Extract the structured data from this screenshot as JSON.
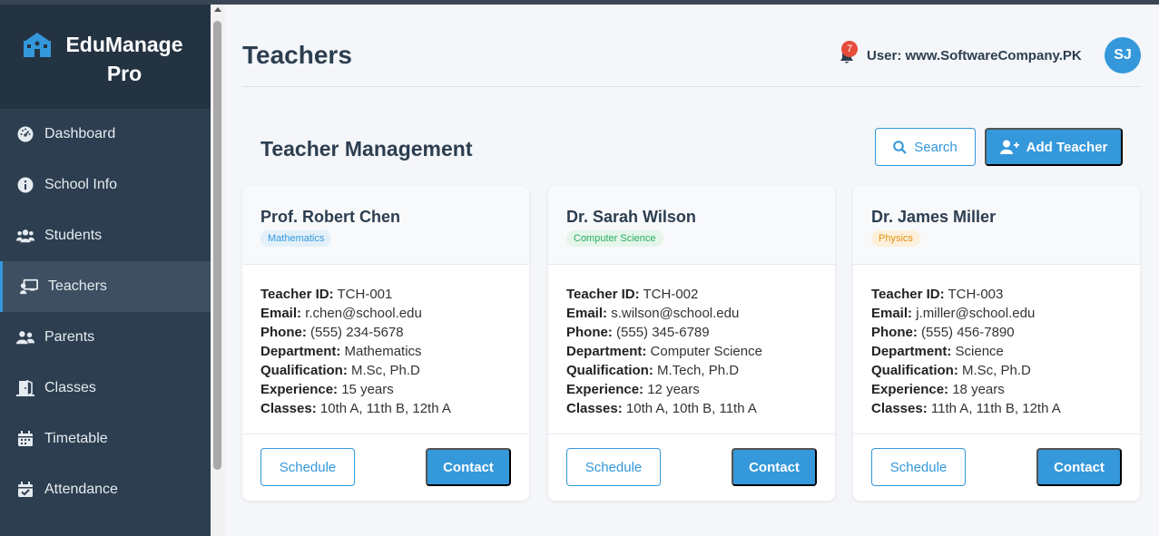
{
  "app": {
    "brand_line1": "EduManage",
    "brand_line2": "Pro"
  },
  "sidebar": {
    "items": [
      {
        "label": "Dashboard",
        "icon": "gauge-icon"
      },
      {
        "label": "School Info",
        "icon": "info-icon"
      },
      {
        "label": "Students",
        "icon": "users-icon"
      },
      {
        "label": "Teachers",
        "icon": "chalkboard-teacher-icon",
        "active": true
      },
      {
        "label": "Parents",
        "icon": "user-friends-icon"
      },
      {
        "label": "Classes",
        "icon": "door-open-icon"
      },
      {
        "label": "Timetable",
        "icon": "calendar-icon"
      },
      {
        "label": "Attendance",
        "icon": "calendar-check-icon"
      }
    ]
  },
  "header": {
    "title": "Teachers",
    "notification_count": "7",
    "user_label": "User: www.SoftwareCompany.PK",
    "avatar_initials": "SJ"
  },
  "section": {
    "title": "Teacher Management",
    "search_label": "Search",
    "add_label": "Add Teacher"
  },
  "labels": {
    "teacher_id": "Teacher ID:",
    "email": "Email:",
    "phone": "Phone:",
    "department": "Department:",
    "qualification": "Qualification:",
    "experience": "Experience:",
    "classes": "Classes:",
    "schedule": "Schedule",
    "contact": "Contact"
  },
  "teachers": [
    {
      "name": "Prof. Robert Chen",
      "tag": "Mathematics",
      "tag_color": "#3498db",
      "tag_bg": "#e3f0fa",
      "id": "TCH-001",
      "email": "r.chen@school.edu",
      "phone": "(555) 234-5678",
      "department": "Mathematics",
      "qualification": "M.Sc, Ph.D",
      "experience": "15 years",
      "classes": "10th A, 11th B, 12th A"
    },
    {
      "name": "Dr. Sarah Wilson",
      "tag": "Computer Science",
      "tag_color": "#27ae60",
      "tag_bg": "#e4f5ea",
      "id": "TCH-002",
      "email": "s.wilson@school.edu",
      "phone": "(555) 345-6789",
      "department": "Computer Science",
      "qualification": "M.Tech, Ph.D",
      "experience": "12 years",
      "classes": "10th A, 10th B, 11th A"
    },
    {
      "name": "Dr. James Miller",
      "tag": "Physics",
      "tag_color": "#e08e0b",
      "tag_bg": "#fdf1dc",
      "id": "TCH-003",
      "email": "j.miller@school.edu",
      "phone": "(555) 456-7890",
      "department": "Science",
      "qualification": "M.Sc, Ph.D",
      "experience": "18 years",
      "classes": "11th A, 11th B, 12th A"
    }
  ]
}
